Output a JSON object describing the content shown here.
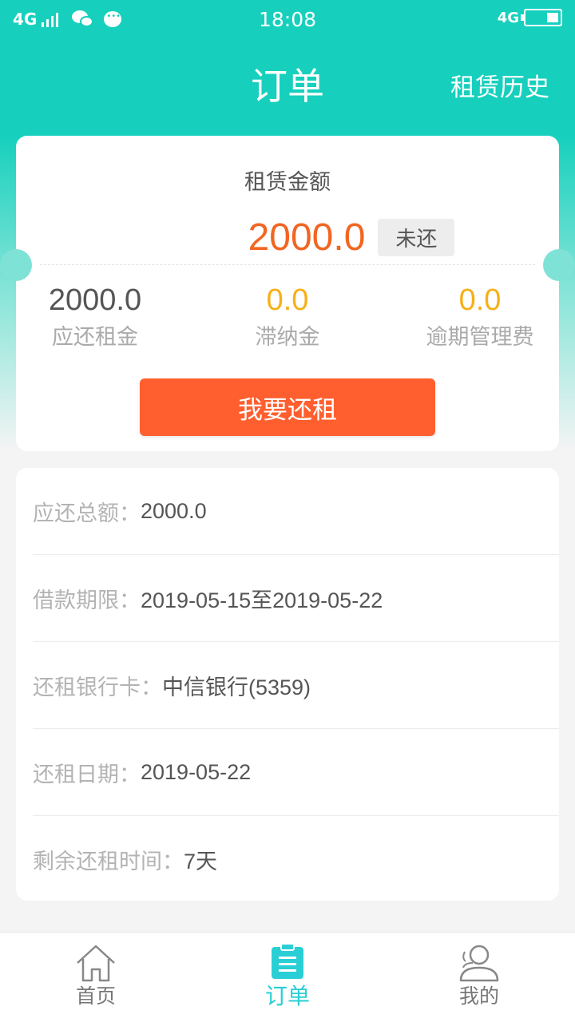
{
  "status_bar": {
    "network_left": "4G",
    "time": "18:08",
    "network_right": "4G"
  },
  "header": {
    "title": "订单",
    "history_link": "租赁历史"
  },
  "summary": {
    "amount_label": "租赁金额",
    "amount": "2000.0",
    "status": "未还",
    "stats": [
      {
        "value": "2000.0",
        "label": "应还租金"
      },
      {
        "value": "0.0",
        "label": "滞纳金"
      },
      {
        "value": "0.0",
        "label": "逾期管理费"
      }
    ],
    "pay_button": "我要还租"
  },
  "details": [
    {
      "label": "应还总额：",
      "value": "2000.0"
    },
    {
      "label": "借款期限：",
      "value": "2019-05-15至2019-05-22"
    },
    {
      "label": "还租银行卡：",
      "value": "中信银行(5359)"
    },
    {
      "label": "还租日期：",
      "value": "2019-05-22"
    },
    {
      "label": "剩余还租时间：",
      "value": "7天"
    }
  ],
  "tabbar": {
    "items": [
      {
        "label": "首页",
        "icon": "home-icon"
      },
      {
        "label": "订单",
        "icon": "order-list-icon"
      },
      {
        "label": "我的",
        "icon": "user-icon"
      }
    ],
    "active_index": 1
  },
  "colors": {
    "brand": "#16d0bd",
    "accent": "#ff5f2f",
    "amount": "#f26522",
    "warning": "#f5b019",
    "tab_active": "#29cfd5"
  }
}
